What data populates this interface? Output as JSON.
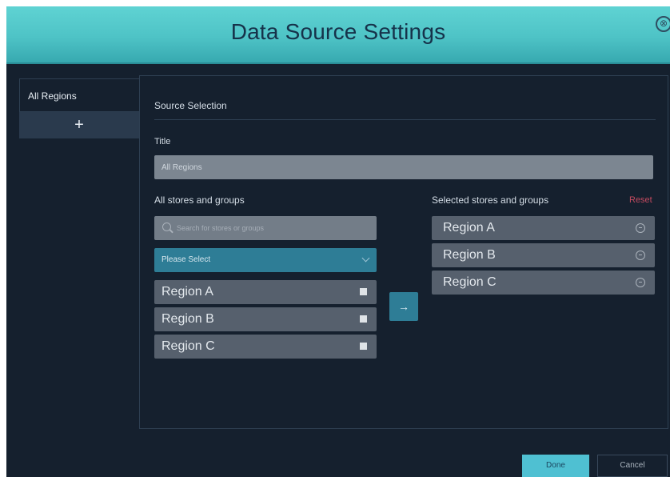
{
  "dialog": {
    "title": "Data Source Settings",
    "close_icon": "close-circle-icon",
    "close_glyph": "⊗"
  },
  "tabs": [
    {
      "label": "All Regions",
      "active": true
    },
    {
      "label": "+",
      "icon": "plus-icon"
    }
  ],
  "source_selection": {
    "heading": "Source Selection",
    "title_label": "Title",
    "title_value": "All Regions"
  },
  "available": {
    "label": "All stores and groups",
    "search_placeholder": "Search for stores or groups",
    "select_value": "Please Select",
    "items": [
      {
        "label": "Region A",
        "checked": false
      },
      {
        "label": "Region B",
        "checked": false
      },
      {
        "label": "Region C",
        "checked": false
      }
    ]
  },
  "move_button": {
    "glyph": "→",
    "icon": "arrow-right-icon"
  },
  "selected": {
    "label": "Selected stores and groups",
    "reset_label": "Reset",
    "items": [
      {
        "label": "Region A",
        "icon": "remove-circle-icon"
      },
      {
        "label": "Region B",
        "icon": "remove-circle-icon"
      },
      {
        "label": "Region C",
        "icon": "remove-circle-icon"
      }
    ]
  },
  "footer": {
    "done_label": "Done",
    "cancel_label": "Cancel"
  },
  "colors": {
    "header_gradient_top": "#5fd3d3",
    "background": "#15202e",
    "accent": "#2e7d96",
    "done_button": "#4fc0d2",
    "reset": "#c24a5f",
    "item_bg": "#56606d"
  }
}
